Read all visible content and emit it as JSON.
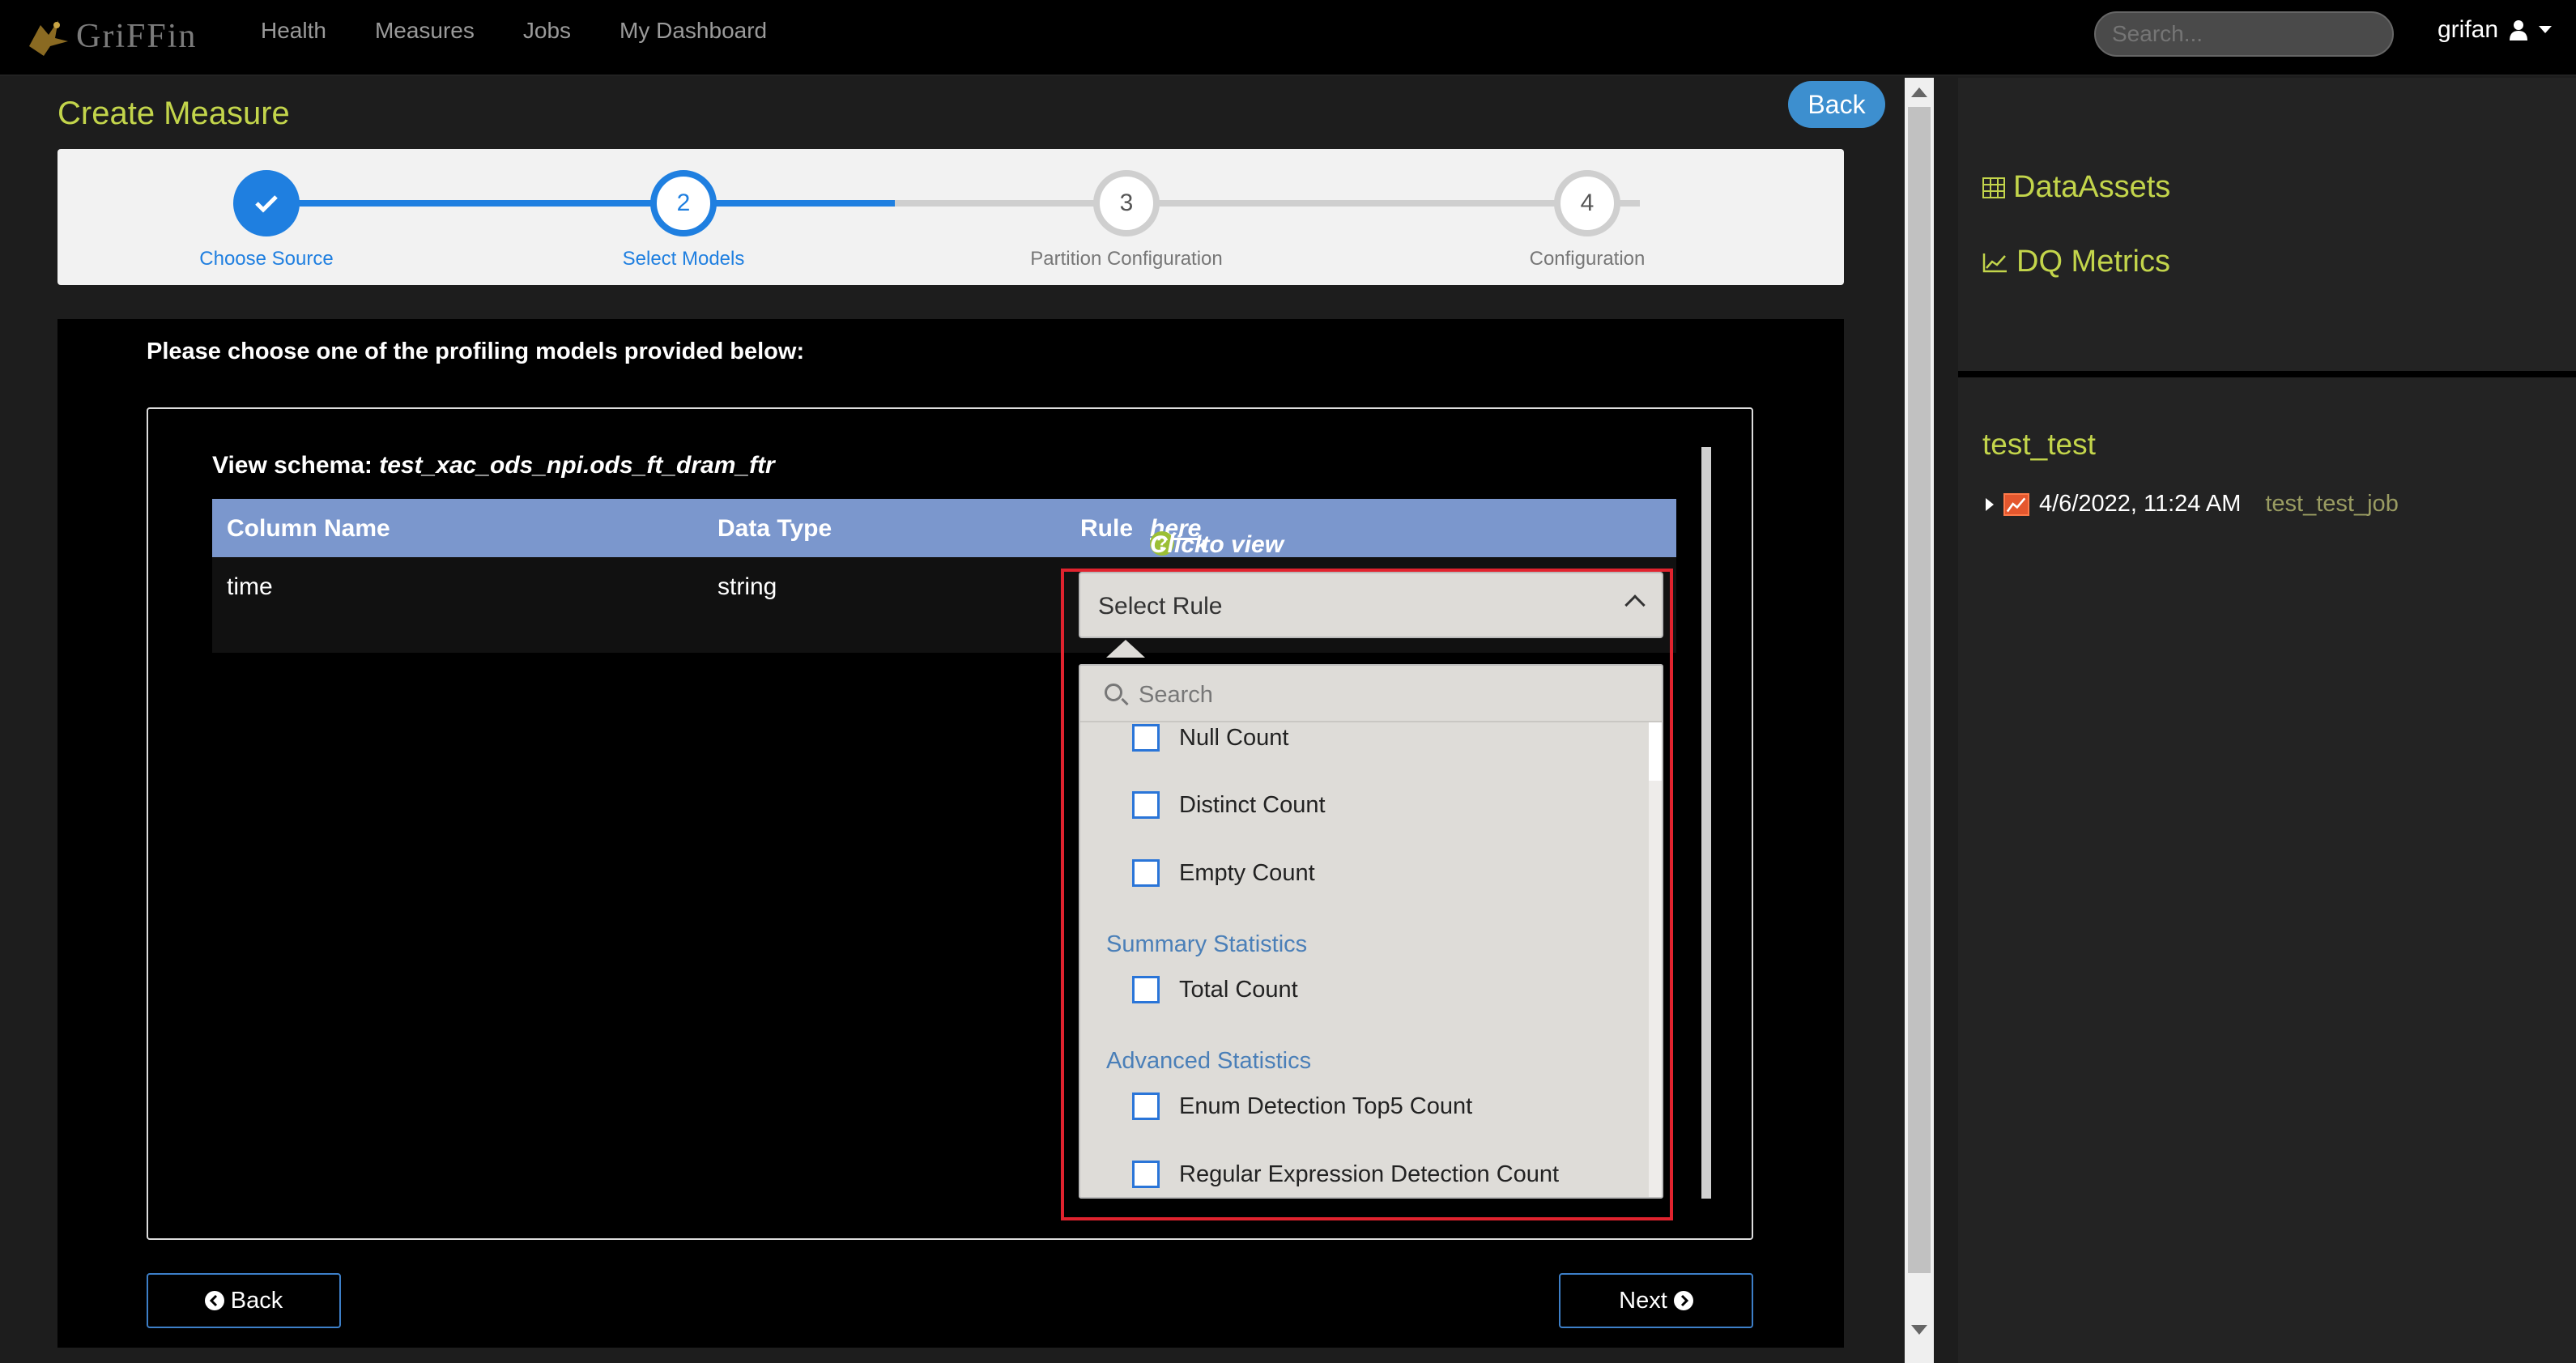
{
  "app": {
    "logo_text": "GriFFin"
  },
  "nav": {
    "items": [
      "Health",
      "Measures",
      "Jobs",
      "My Dashboard"
    ]
  },
  "search": {
    "placeholder": "Search..."
  },
  "user": {
    "name": "grifan"
  },
  "page": {
    "title": "Create Measure",
    "back_label": "Back"
  },
  "steps": [
    {
      "number": "1",
      "label": "Choose Source",
      "state": "done"
    },
    {
      "number": "2",
      "label": "Select Models",
      "state": "active"
    },
    {
      "number": "3",
      "label": "Partition Configuration",
      "state": "todo"
    },
    {
      "number": "4",
      "label": "Configuration",
      "state": "todo"
    }
  ],
  "models": {
    "prompt": "Please choose one of the profiling models provided below:",
    "schema_label": "View schema:",
    "schema_value": "test_xac_ods_npi.ods_ft_dram_ftr",
    "columns": {
      "name": "Column Name",
      "type": "Data Type",
      "rule": "Rule"
    },
    "rule_help": {
      "prefix": "Click ",
      "link": "here",
      "suffix": " to view the rule definition"
    },
    "row": {
      "name": "time",
      "type": "string"
    },
    "select": {
      "placeholder": "Select Rule",
      "search_placeholder": "Search"
    },
    "options": {
      "null_count": "Null Count",
      "distinct_count": "Distinct Count",
      "empty_count": "Empty Count",
      "group_summary": "Summary Statistics",
      "total_count": "Total Count",
      "group_advanced": "Advanced Statistics",
      "enum_top5": "Enum Detection Top5 Count",
      "regex_count": "Regular Expression Detection Count"
    }
  },
  "buttons": {
    "back": "Back",
    "next": "Next"
  },
  "sidebar": {
    "links": [
      "DataAssets",
      "DQ Metrics"
    ],
    "project": "test_test",
    "item": {
      "datetime": "4/6/2022, 11:24 AM",
      "job": "test_test_job"
    }
  },
  "colors": {
    "accent": "#c3d54b",
    "primary": "#1f7fe0",
    "table_header": "#7b97cd",
    "highlight": "#e0232e"
  }
}
